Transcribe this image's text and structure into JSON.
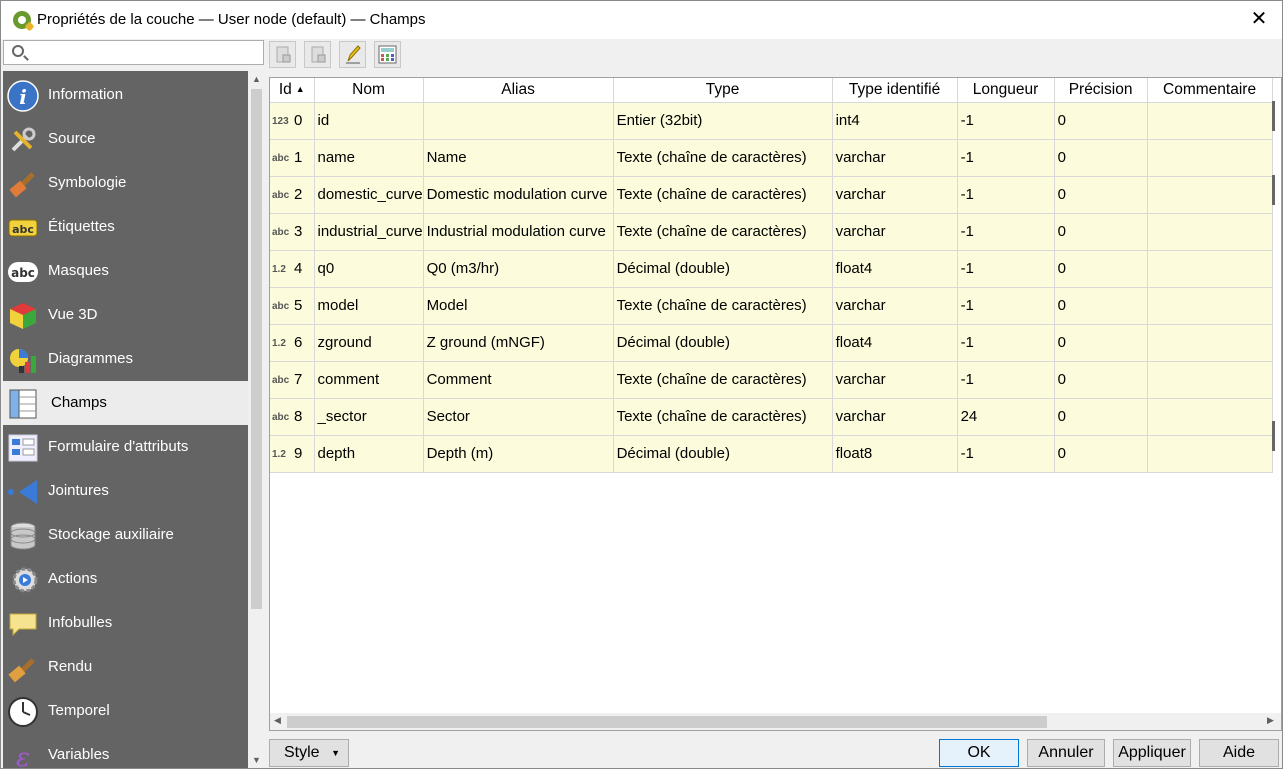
{
  "window": {
    "title": "Propriétés de la couche — User node (default) — Champs",
    "close_label": "✕"
  },
  "search": {
    "placeholder": ""
  },
  "sidebar": {
    "items": [
      {
        "label": "Information",
        "icon": "information-icon"
      },
      {
        "label": "Source",
        "icon": "source-icon"
      },
      {
        "label": "Symbologie",
        "icon": "symbology-icon"
      },
      {
        "label": "Étiquettes",
        "icon": "labels-icon"
      },
      {
        "label": "Masques",
        "icon": "masks-icon"
      },
      {
        "label": "Vue 3D",
        "icon": "3d-view-icon"
      },
      {
        "label": "Diagrammes",
        "icon": "diagrams-icon"
      },
      {
        "label": "Champs",
        "icon": "fields-icon",
        "active": true
      },
      {
        "label": "Formulaire d'attributs",
        "icon": "attribute-form-icon"
      },
      {
        "label": "Jointures",
        "icon": "joins-icon"
      },
      {
        "label": "Stockage auxiliaire",
        "icon": "auxiliary-storage-icon"
      },
      {
        "label": "Actions",
        "icon": "actions-icon"
      },
      {
        "label": "Infobulles",
        "icon": "tooltips-icon"
      },
      {
        "label": "Rendu",
        "icon": "rendering-icon"
      },
      {
        "label": "Temporel",
        "icon": "temporal-icon"
      },
      {
        "label": "Variables",
        "icon": "variables-icon"
      }
    ]
  },
  "toolbar": {
    "buttons": [
      "new-field-icon",
      "delete-field-icon",
      "toggle-editing-icon",
      "field-calculator-icon"
    ]
  },
  "table": {
    "headers": [
      "Id",
      "Nom",
      "Alias",
      "Type",
      "Type identifié",
      "Longueur",
      "Précision",
      "Commentaire"
    ],
    "rows": [
      {
        "badge": "123",
        "id": "0",
        "name": "id",
        "alias": "",
        "type": "Entier (32bit)",
        "typename": "int4",
        "length": "-1",
        "precision": "0",
        "comment": ""
      },
      {
        "badge": "abc",
        "id": "1",
        "name": "name",
        "alias": "Name",
        "type": "Texte (chaîne de caractères)",
        "typename": "varchar",
        "length": "-1",
        "precision": "0",
        "comment": ""
      },
      {
        "badge": "abc",
        "id": "2",
        "name": "domestic_curve",
        "alias": "Domestic modulation curve",
        "type": "Texte (chaîne de caractères)",
        "typename": "varchar",
        "length": "-1",
        "precision": "0",
        "comment": ""
      },
      {
        "badge": "abc",
        "id": "3",
        "name": "industrial_curve",
        "alias": "Industrial modulation curve",
        "type": "Texte (chaîne de caractères)",
        "typename": "varchar",
        "length": "-1",
        "precision": "0",
        "comment": ""
      },
      {
        "badge": "1.2",
        "id": "4",
        "name": "q0",
        "alias": "Q0 (m3/hr)",
        "type": "Décimal (double)",
        "typename": "float4",
        "length": "-1",
        "precision": "0",
        "comment": ""
      },
      {
        "badge": "abc",
        "id": "5",
        "name": "model",
        "alias": "Model",
        "type": "Texte (chaîne de caractères)",
        "typename": "varchar",
        "length": "-1",
        "precision": "0",
        "comment": ""
      },
      {
        "badge": "1.2",
        "id": "6",
        "name": "zground",
        "alias": "Z ground (mNGF)",
        "type": "Décimal (double)",
        "typename": "float4",
        "length": "-1",
        "precision": "0",
        "comment": ""
      },
      {
        "badge": "abc",
        "id": "7",
        "name": "comment",
        "alias": "Comment",
        "type": "Texte (chaîne de caractères)",
        "typename": "varchar",
        "length": "-1",
        "precision": "0",
        "comment": ""
      },
      {
        "badge": "abc",
        "id": "8",
        "name": "_sector",
        "alias": "Sector",
        "type": "Texte (chaîne de caractères)",
        "typename": "varchar",
        "length": "24",
        "precision": "0",
        "comment": ""
      },
      {
        "badge": "1.2",
        "id": "9",
        "name": "depth",
        "alias": "Depth (m)",
        "type": "Décimal (double)",
        "typename": "float8",
        "length": "-1",
        "precision": "0",
        "comment": ""
      }
    ]
  },
  "footer": {
    "style_label": "Style",
    "ok_label": "OK",
    "cancel_label": "Annuler",
    "apply_label": "Appliquer",
    "help_label": "Aide"
  },
  "colors": {
    "sidebar_bg": "#646464",
    "row_bg": "#fcfcdc",
    "active_item_bg": "#ececec",
    "ok_border": "#0078d7"
  }
}
